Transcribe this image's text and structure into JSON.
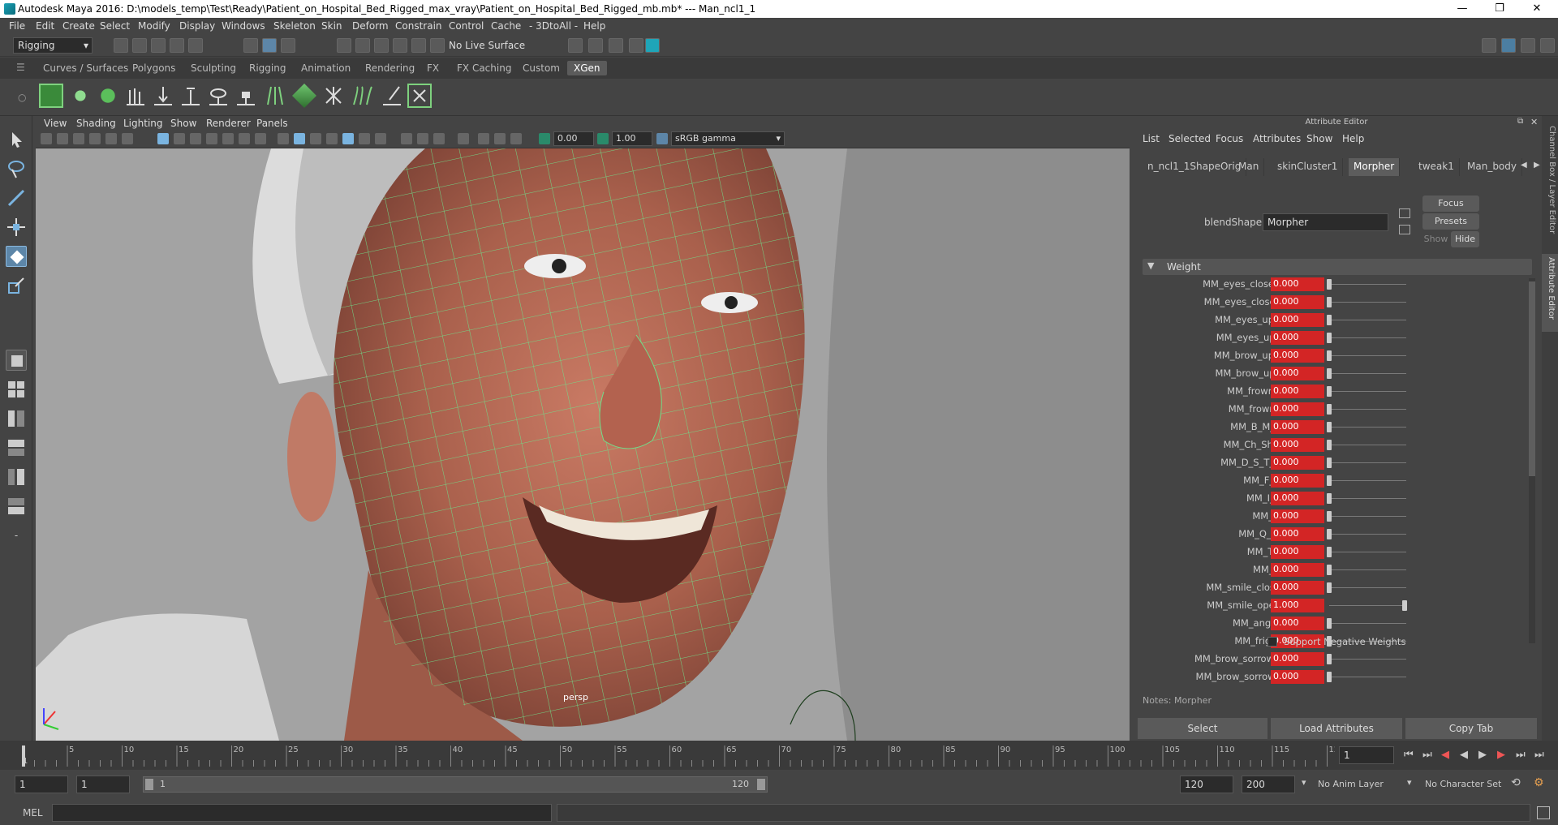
{
  "title_bar": {
    "text": "Autodesk Maya 2016: D:\\models_temp\\Test\\Ready\\Patient_on_Hospital_Bed_Rigged_max_vray\\Patient_on_Hospital_Bed_Rigged_mb.mb*   ---   Man_ncl1_1",
    "minimize": "—",
    "maximize": "❐",
    "close": "✕"
  },
  "menu": [
    "File",
    "Edit",
    "Create",
    "Select",
    "Modify",
    "Display",
    "Windows",
    "Skeleton",
    "Skin",
    "Deform",
    "Constrain",
    "Control",
    "Cache",
    "- 3DtoAll -",
    "Help"
  ],
  "status_line": {
    "menu_set": "Rigging",
    "live_surface": "No Live Surface"
  },
  "shelf_tabs": [
    "Curves / Surfaces",
    "Polygons",
    "Sculpting",
    "Rigging",
    "Animation",
    "Rendering",
    "FX",
    "FX Caching",
    "Custom",
    "XGen"
  ],
  "active_shelf": "XGen",
  "viewport": {
    "menus": [
      "View",
      "Shading",
      "Lighting",
      "Show",
      "Renderer",
      "Panels"
    ],
    "exposure": "0.00",
    "gamma": "1.00",
    "color_space": "sRGB gamma",
    "camera_label": "persp"
  },
  "attribute_editor": {
    "title": "Attribute Editor",
    "menus": [
      "List",
      "Selected",
      "Focus",
      "Attributes",
      "Show",
      "Help"
    ],
    "tabs": [
      "n_ncl1_1ShapeOrig",
      "Man",
      "skinCluster1",
      "Morpher",
      "tweak1",
      "Man_body"
    ],
    "active_tab": "Morpher",
    "blendshape_label": "blendShape:",
    "blendshape_value": "Morpher",
    "buttons": {
      "focus": "Focus",
      "presets": "Presets",
      "show": "Show",
      "hide": "Hide"
    },
    "section": "Weight",
    "weights": [
      {
        "name": "MM_eyes_closeR",
        "value": "0.000",
        "level": 0
      },
      {
        "name": "MM_eyes_closeL",
        "value": "0.000",
        "level": 0
      },
      {
        "name": "MM_eyes_upR",
        "value": "0.000",
        "level": 0
      },
      {
        "name": "MM_eyes_upL",
        "value": "0.000",
        "level": 0
      },
      {
        "name": "MM_brow_upR",
        "value": "0.000",
        "level": 0
      },
      {
        "name": "MM_brow_upL",
        "value": "0.000",
        "level": 0
      },
      {
        "name": "MM_frownR",
        "value": "0.000",
        "level": 0
      },
      {
        "name": "MM_frownL",
        "value": "0.000",
        "level": 0
      },
      {
        "name": "MM_B_M_P",
        "value": "0.000",
        "level": 0
      },
      {
        "name": "MM_Ch_Sh_J",
        "value": "0.000",
        "level": 0
      },
      {
        "name": "MM_D_S_T_Z",
        "value": "0.000",
        "level": 0
      },
      {
        "name": "MM_F_V",
        "value": "0.000",
        "level": 0
      },
      {
        "name": "MM_I_E",
        "value": "0.000",
        "level": 0
      },
      {
        "name": "MM_O",
        "value": "0.000",
        "level": 0
      },
      {
        "name": "MM_Q_W",
        "value": "0.000",
        "level": 0
      },
      {
        "name": "MM_TH",
        "value": "0.000",
        "level": 0
      },
      {
        "name": "MM_U",
        "value": "0.000",
        "level": 0
      },
      {
        "name": "MM_smile_close",
        "value": "0.000",
        "level": 0
      },
      {
        "name": "MM_smile_open",
        "value": "1.000",
        "level": 1
      },
      {
        "name": "MM_anger",
        "value": "0.000",
        "level": 0
      },
      {
        "name": "MM_fright",
        "value": "0.000",
        "level": 0
      },
      {
        "name": "MM_brow_sorrowR",
        "value": "0.000",
        "level": 0
      },
      {
        "name": "MM_brow_sorrowL",
        "value": "0.000",
        "level": 0
      }
    ],
    "support_negative": "Support Negative Weights",
    "notes": "Notes:  Morpher",
    "bottom_buttons": [
      "Select",
      "Load Attributes",
      "Copy Tab"
    ]
  },
  "side_tabs": [
    "Channel Box / Layer Editor",
    "Attribute Editor"
  ],
  "timeline": {
    "ticks": [
      "5",
      "10",
      "15",
      "20",
      "25",
      "30",
      "35",
      "40",
      "45",
      "50",
      "55",
      "60",
      "65",
      "70",
      "75",
      "80",
      "85",
      "90",
      "95",
      "100",
      "105",
      "110",
      "115",
      "120"
    ],
    "current_frame": "1",
    "current_frame_marker": "1"
  },
  "range": {
    "start": "1",
    "playback_start": "1",
    "slider_start": "1",
    "slider_end": "120",
    "playback_end": "120",
    "end": "200",
    "anim_layer": "No Anim Layer",
    "character_set": "No Character Set"
  },
  "command": {
    "lang": "MEL"
  }
}
